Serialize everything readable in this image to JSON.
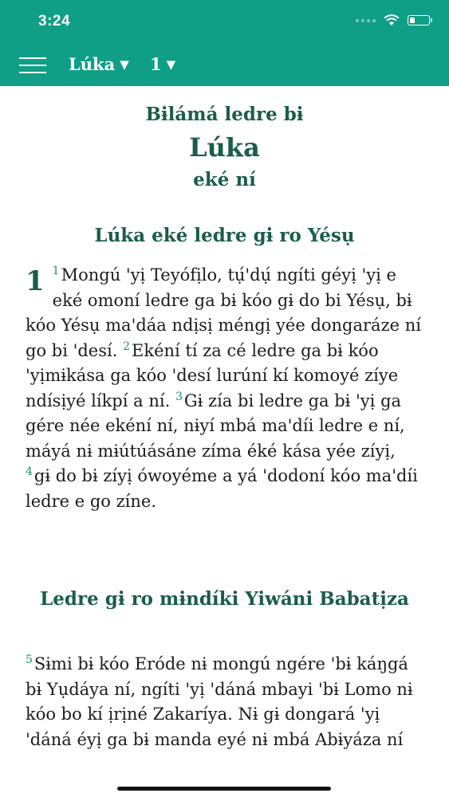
{
  "status": {
    "time": "3:24"
  },
  "nav": {
    "book": "Lúka",
    "chapter": "1"
  },
  "book_heading": {
    "line1": "Bɨlámá ledre bɨ",
    "line2": "Lúka",
    "line3": "eké ní"
  },
  "sections": [
    {
      "title": "Lúka eké ledre gɨ ro Yésụ",
      "chapter_number": "1",
      "verses": [
        {
          "n": "1",
          "text": "Mongú 'yị Teyófịlo, tụ́'dụ́ ngíti géyị 'yị e eké omoní ledre ga bɨ kóo gɨ do bi Yésụ, bɨ kóo Yésụ ma'dáa ndịsị méngị yée dongaráze ní go bi 'desí. "
        },
        {
          "n": "2",
          "text": "Ekéní tí za cé ledre ga bɨ kóo 'yịmɨkása ga kóo 'desí lurúní kí komoyé zíye ndísịyé líkpí a ní. "
        },
        {
          "n": "3",
          "text": "Gɨ zía bi ledre ga bɨ 'yị ga gére née ekéní ní, nɨyí mbá ma'díi ledre e ní, máyá nɨ mɨútúásáne zíma éké kása yée zíyị, "
        },
        {
          "n": "4",
          "text": "gɨ do bɨ zíyị ówoyéme a yá 'dodoní kóo ma'díi ledre e go zíne."
        }
      ]
    },
    {
      "title": "Ledre gɨ ro mɨndíki Yiwáni Babatịza",
      "verses": [
        {
          "n": "5",
          "text": "Sɨmi bɨ kóo Eróde nɨ mongú ngére 'bɨ káŋgá bɨ Yụdáya ní, ngíti 'yị 'dáná mbayi 'bɨ Lomo nɨ kóo bo kí ịrịné Zakaríya. Nɨ gɨ dongará 'yị 'dáná éyị ga bɨ manda eyé nɨ mbá Abɨyáza ní"
        }
      ]
    }
  ]
}
